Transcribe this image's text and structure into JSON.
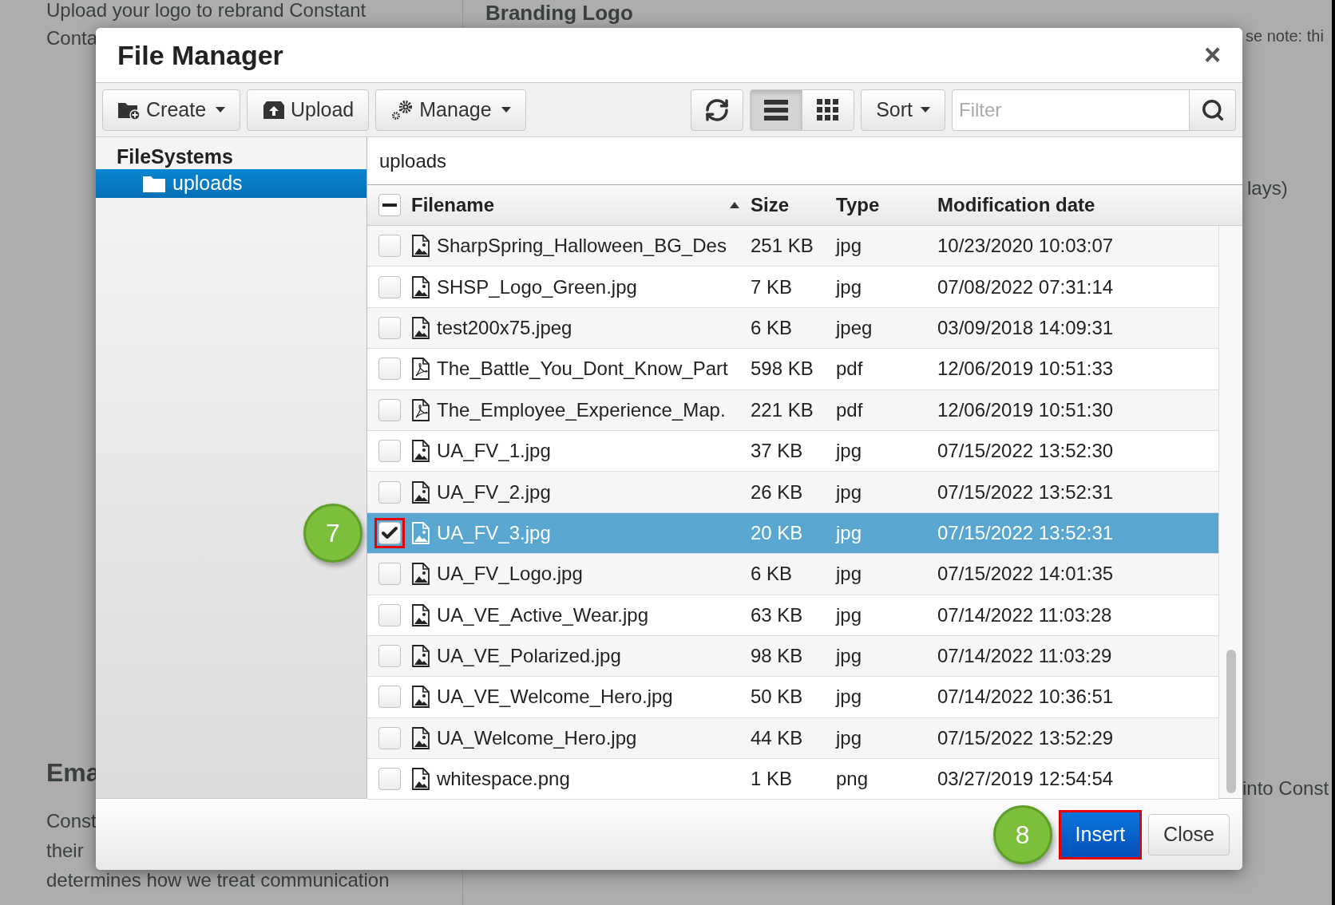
{
  "background": {
    "left_texts": [
      "Upload your logo to rebrand Constant",
      "Conta"
    ],
    "left_heading": "Ema",
    "left_paragraph": [
      "Const",
      "their",
      "determines how we treat communication"
    ],
    "right_heading": "Branding Logo",
    "right_texts": [
      "se note: thi",
      "lays)",
      "into Const"
    ]
  },
  "dialog": {
    "title": "File Manager",
    "close_label": "×",
    "toolbar": [
      {
        "kind": "create",
        "label": "Create",
        "dropdown": true
      },
      {
        "kind": "upload",
        "label": "Upload",
        "dropdown": false
      },
      {
        "kind": "manage",
        "label": "Manage",
        "dropdown": true
      }
    ],
    "views": [
      {
        "kind": "list",
        "selected": true
      },
      {
        "kind": "grid",
        "selected": false
      }
    ],
    "sort": {
      "label": "Sort"
    },
    "filter": {
      "placeholder": "Filter"
    },
    "tree": {
      "root": "FileSystems",
      "children": [
        {
          "label": "uploads",
          "selected": true
        }
      ]
    },
    "path": "uploads",
    "select_all": {
      "indeterminate": true
    },
    "columns": [
      {
        "label": "Filename",
        "sorted": true
      },
      {
        "label": "Size",
        "sorted": false
      },
      {
        "label": "Type",
        "sorted": false
      },
      {
        "label": "Modification date",
        "sorted": false
      }
    ],
    "rows": [
      {
        "kind": "image",
        "name": "SharpSpring_Halloween_BG_Des",
        "size": "251 KB",
        "type": "jpg",
        "date": "10/23/2020 10:03:07",
        "selected": false
      },
      {
        "kind": "image",
        "name": "SHSP_Logo_Green.jpg",
        "size": "7 KB",
        "type": "jpg",
        "date": "07/08/2022 07:31:14",
        "selected": false
      },
      {
        "kind": "image",
        "name": "test200x75.jpeg",
        "size": "6 KB",
        "type": "jpeg",
        "date": "03/09/2018 14:09:31",
        "selected": false
      },
      {
        "kind": "pdf",
        "name": "The_Battle_You_Dont_Know_Part",
        "size": "598 KB",
        "type": "pdf",
        "date": "12/06/2019 10:51:33",
        "selected": false
      },
      {
        "kind": "pdf",
        "name": "The_Employee_Experience_Map.",
        "size": "221 KB",
        "type": "pdf",
        "date": "12/06/2019 10:51:30",
        "selected": false
      },
      {
        "kind": "image",
        "name": "UA_FV_1.jpg",
        "size": "37 KB",
        "type": "jpg",
        "date": "07/15/2022 13:52:30",
        "selected": false
      },
      {
        "kind": "image",
        "name": "UA_FV_2.jpg",
        "size": "26 KB",
        "type": "jpg",
        "date": "07/15/2022 13:52:31",
        "selected": false
      },
      {
        "kind": "image",
        "name": "UA_FV_3.jpg",
        "size": "20 KB",
        "type": "jpg",
        "date": "07/15/2022 13:52:31",
        "selected": true,
        "step": "7"
      },
      {
        "kind": "image",
        "name": "UA_FV_Logo.jpg",
        "size": "6 KB",
        "type": "jpg",
        "date": "07/15/2022 14:01:35",
        "selected": false
      },
      {
        "kind": "image",
        "name": "UA_VE_Active_Wear.jpg",
        "size": "63 KB",
        "type": "jpg",
        "date": "07/14/2022 11:03:28",
        "selected": false
      },
      {
        "kind": "image",
        "name": "UA_VE_Polarized.jpg",
        "size": "98 KB",
        "type": "jpg",
        "date": "07/14/2022 11:03:29",
        "selected": false
      },
      {
        "kind": "image",
        "name": "UA_VE_Welcome_Hero.jpg",
        "size": "50 KB",
        "type": "jpg",
        "date": "07/14/2022 10:36:51",
        "selected": false
      },
      {
        "kind": "image",
        "name": "UA_Welcome_Hero.jpg",
        "size": "44 KB",
        "type": "jpg",
        "date": "07/15/2022 13:52:29",
        "selected": false
      },
      {
        "kind": "image",
        "name": "whitespace.png",
        "size": "1 KB",
        "type": "png",
        "date": "03/27/2019 12:54:54",
        "selected": false
      }
    ],
    "buttons": [
      {
        "kind": "primary",
        "label": "Insert",
        "step": "8"
      },
      {
        "kind": "default",
        "label": "Close"
      }
    ]
  }
}
